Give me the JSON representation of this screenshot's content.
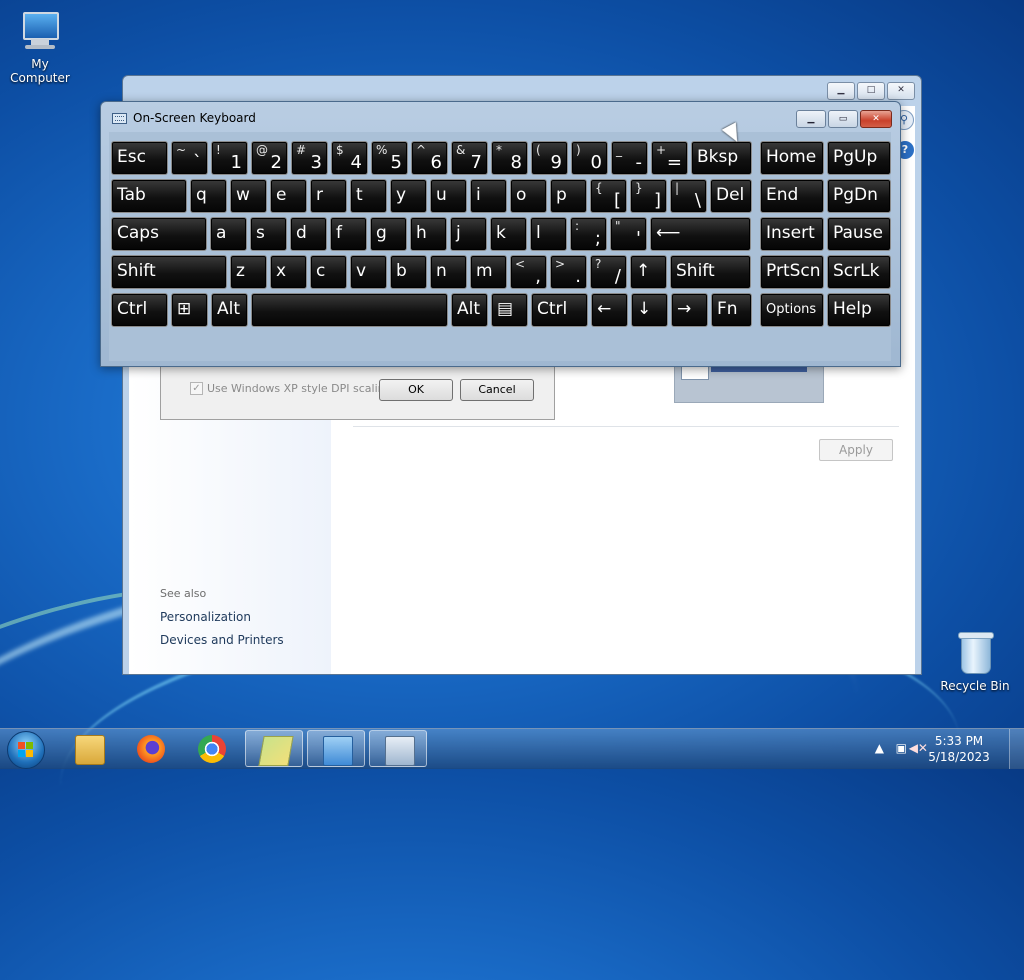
{
  "desktop": {
    "icons": [
      {
        "label": "My Computer",
        "icon": "computer-icon"
      },
      {
        "label": "Recycle Bin",
        "icon": "recycle-bin-icon"
      }
    ]
  },
  "control_panel": {
    "see_also": "See also",
    "links": [
      "Personalization",
      "Devices and Printers"
    ],
    "apply_label": "Apply",
    "dpi_checkbox_label": "Use Windows XP style DPI scaling",
    "ok_label": "OK",
    "cancel_label": "Cancel",
    "help_glyph": "?"
  },
  "osk": {
    "title": "On-Screen Keyboard",
    "caption_buttons": [
      "minimize-icon",
      "restore-icon",
      "close-icon"
    ],
    "rows": [
      [
        {
          "label": "Esc"
        },
        {
          "shift": "~",
          "base": "`"
        },
        {
          "shift": "!",
          "base": "1"
        },
        {
          "shift": "@",
          "base": "2"
        },
        {
          "shift": "#",
          "base": "3"
        },
        {
          "shift": "$",
          "base": "4"
        },
        {
          "shift": "%",
          "base": "5"
        },
        {
          "shift": "^",
          "base": "6"
        },
        {
          "shift": "&",
          "base": "7"
        },
        {
          "shift": "*",
          "base": "8"
        },
        {
          "shift": "(",
          "base": "9"
        },
        {
          "shift": ")",
          "base": "0"
        },
        {
          "shift": "_",
          "base": "-"
        },
        {
          "shift": "+",
          "base": "="
        },
        {
          "label": "Bksp"
        },
        {
          "label": "Home"
        },
        {
          "label": "PgUp"
        }
      ],
      [
        {
          "label": "Tab"
        },
        {
          "label": "q"
        },
        {
          "label": "w"
        },
        {
          "label": "e"
        },
        {
          "label": "r"
        },
        {
          "label": "t"
        },
        {
          "label": "y"
        },
        {
          "label": "u"
        },
        {
          "label": "i"
        },
        {
          "label": "o"
        },
        {
          "label": "p"
        },
        {
          "shift": "{",
          "base": "["
        },
        {
          "shift": "}",
          "base": "]"
        },
        {
          "shift": "|",
          "base": "\\"
        },
        {
          "label": "Del"
        },
        {
          "label": "End"
        },
        {
          "label": "PgDn"
        }
      ],
      [
        {
          "label": "Caps"
        },
        {
          "label": "a"
        },
        {
          "label": "s"
        },
        {
          "label": "d"
        },
        {
          "label": "f"
        },
        {
          "label": "g"
        },
        {
          "label": "h"
        },
        {
          "label": "j"
        },
        {
          "label": "k"
        },
        {
          "label": "l"
        },
        {
          "shift": ":",
          "base": ";"
        },
        {
          "shift": "\"",
          "base": "'"
        },
        {
          "label": "⟵"
        },
        {
          "label": "Insert"
        },
        {
          "label": "Pause"
        }
      ],
      [
        {
          "label": "Shift"
        },
        {
          "label": "z"
        },
        {
          "label": "x"
        },
        {
          "label": "c"
        },
        {
          "label": "v"
        },
        {
          "label": "b"
        },
        {
          "label": "n"
        },
        {
          "label": "m"
        },
        {
          "shift": "<",
          "base": ","
        },
        {
          "shift": ">",
          "base": "."
        },
        {
          "shift": "?",
          "base": "/"
        },
        {
          "label": "↑"
        },
        {
          "label": "Shift"
        },
        {
          "label": "PrtScn"
        },
        {
          "label": "ScrLk"
        }
      ],
      [
        {
          "label": "Ctrl"
        },
        {
          "label": "⊞"
        },
        {
          "label": "Alt"
        },
        {
          "label": ""
        },
        {
          "label": "Alt"
        },
        {
          "label": "▤"
        },
        {
          "label": "Ctrl"
        },
        {
          "label": "←"
        },
        {
          "label": "↓"
        },
        {
          "label": "→"
        },
        {
          "label": "Fn"
        },
        {
          "label": "Options"
        },
        {
          "label": "Help"
        }
      ]
    ]
  },
  "taskbar": {
    "apps": [
      "windows-explorer-icon",
      "firefox-icon",
      "chrome-icon",
      "folder-icon",
      "control-panel-icon",
      "on-screen-keyboard-icon"
    ],
    "time": "5:33 PM",
    "date": "5/18/2023"
  }
}
